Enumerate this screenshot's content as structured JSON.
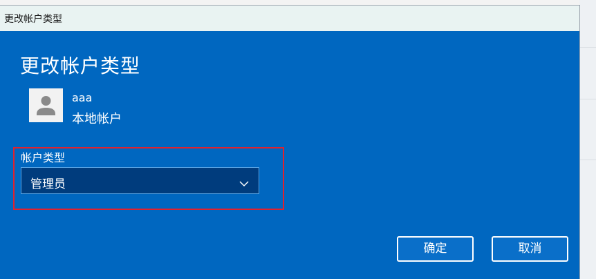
{
  "window": {
    "title": "更改帐户类型"
  },
  "dialog": {
    "heading": "更改帐户类型",
    "user": {
      "name": "aaa",
      "type": "本地帐户",
      "avatar_icon": "user-avatar-icon"
    },
    "account_type": {
      "label": "帐户类型",
      "selected": "管理员",
      "dropdown_icon": "chevron-down-icon"
    },
    "buttons": {
      "ok_label": "确定",
      "cancel_label": "取消"
    }
  },
  "colors": {
    "dialog_background": "#0067c0",
    "select_background": "#003c7d",
    "highlight_border": "#e0222e",
    "text": "#ffffff"
  }
}
